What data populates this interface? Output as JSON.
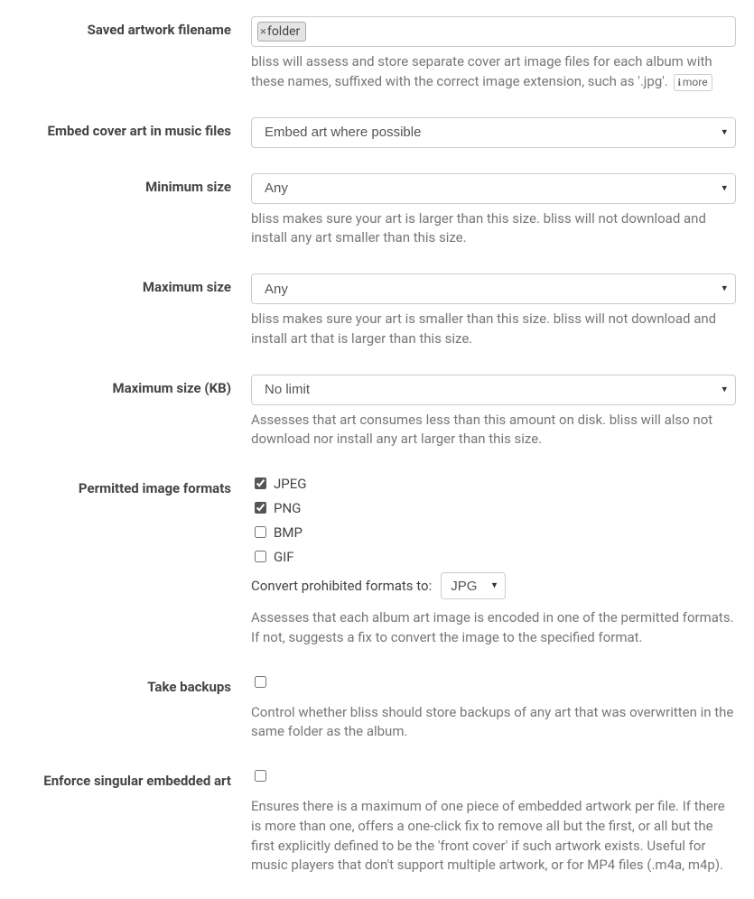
{
  "saved_artwork": {
    "label": "Saved artwork filename",
    "tag": "folder",
    "help": "bliss will assess and store separate cover art image files for each album with these names, suffixed with the correct image extension, such as '.jpg'.",
    "more": "more"
  },
  "embed": {
    "label": "Embed cover art in music files",
    "value": "Embed art where possible"
  },
  "min_size": {
    "label": "Minimum size",
    "value": "Any",
    "help": "bliss makes sure your art is larger than this size. bliss will not download and install any art smaller than this size."
  },
  "max_size": {
    "label": "Maximum size",
    "value": "Any",
    "help": "bliss makes sure your art is smaller than this size. bliss will not download and install art that is larger than this size."
  },
  "max_kb": {
    "label": "Maximum size (KB)",
    "value": "No limit",
    "help": "Assesses that art consumes less than this amount on disk. bliss will also not download nor install any art larger than this size."
  },
  "formats": {
    "label": "Permitted image formats",
    "options": [
      {
        "name": "JPEG",
        "checked": true
      },
      {
        "name": "PNG",
        "checked": true
      },
      {
        "name": "BMP",
        "checked": false
      },
      {
        "name": "GIF",
        "checked": false
      }
    ],
    "convert_label": "Convert prohibited formats to:",
    "convert_value": "JPG",
    "help": "Assesses that each album art image is encoded in one of the permitted formats. If not, suggests a fix to convert the image to the specified format."
  },
  "backups": {
    "label": "Take backups",
    "checked": false,
    "help": "Control whether bliss should store backups of any art that was overwritten in the same folder as the album."
  },
  "singular": {
    "label": "Enforce singular embedded art",
    "checked": false,
    "help": "Ensures there is a maximum of one piece of embedded artwork per file. If there is more than one, offers a one-click fix to remove all but the first, or all but the first explicitly defined to be the 'front cover' if such artwork exists. Useful for music players that don't support multiple artwork, or for MP4 files (.m4a, m4p)."
  }
}
